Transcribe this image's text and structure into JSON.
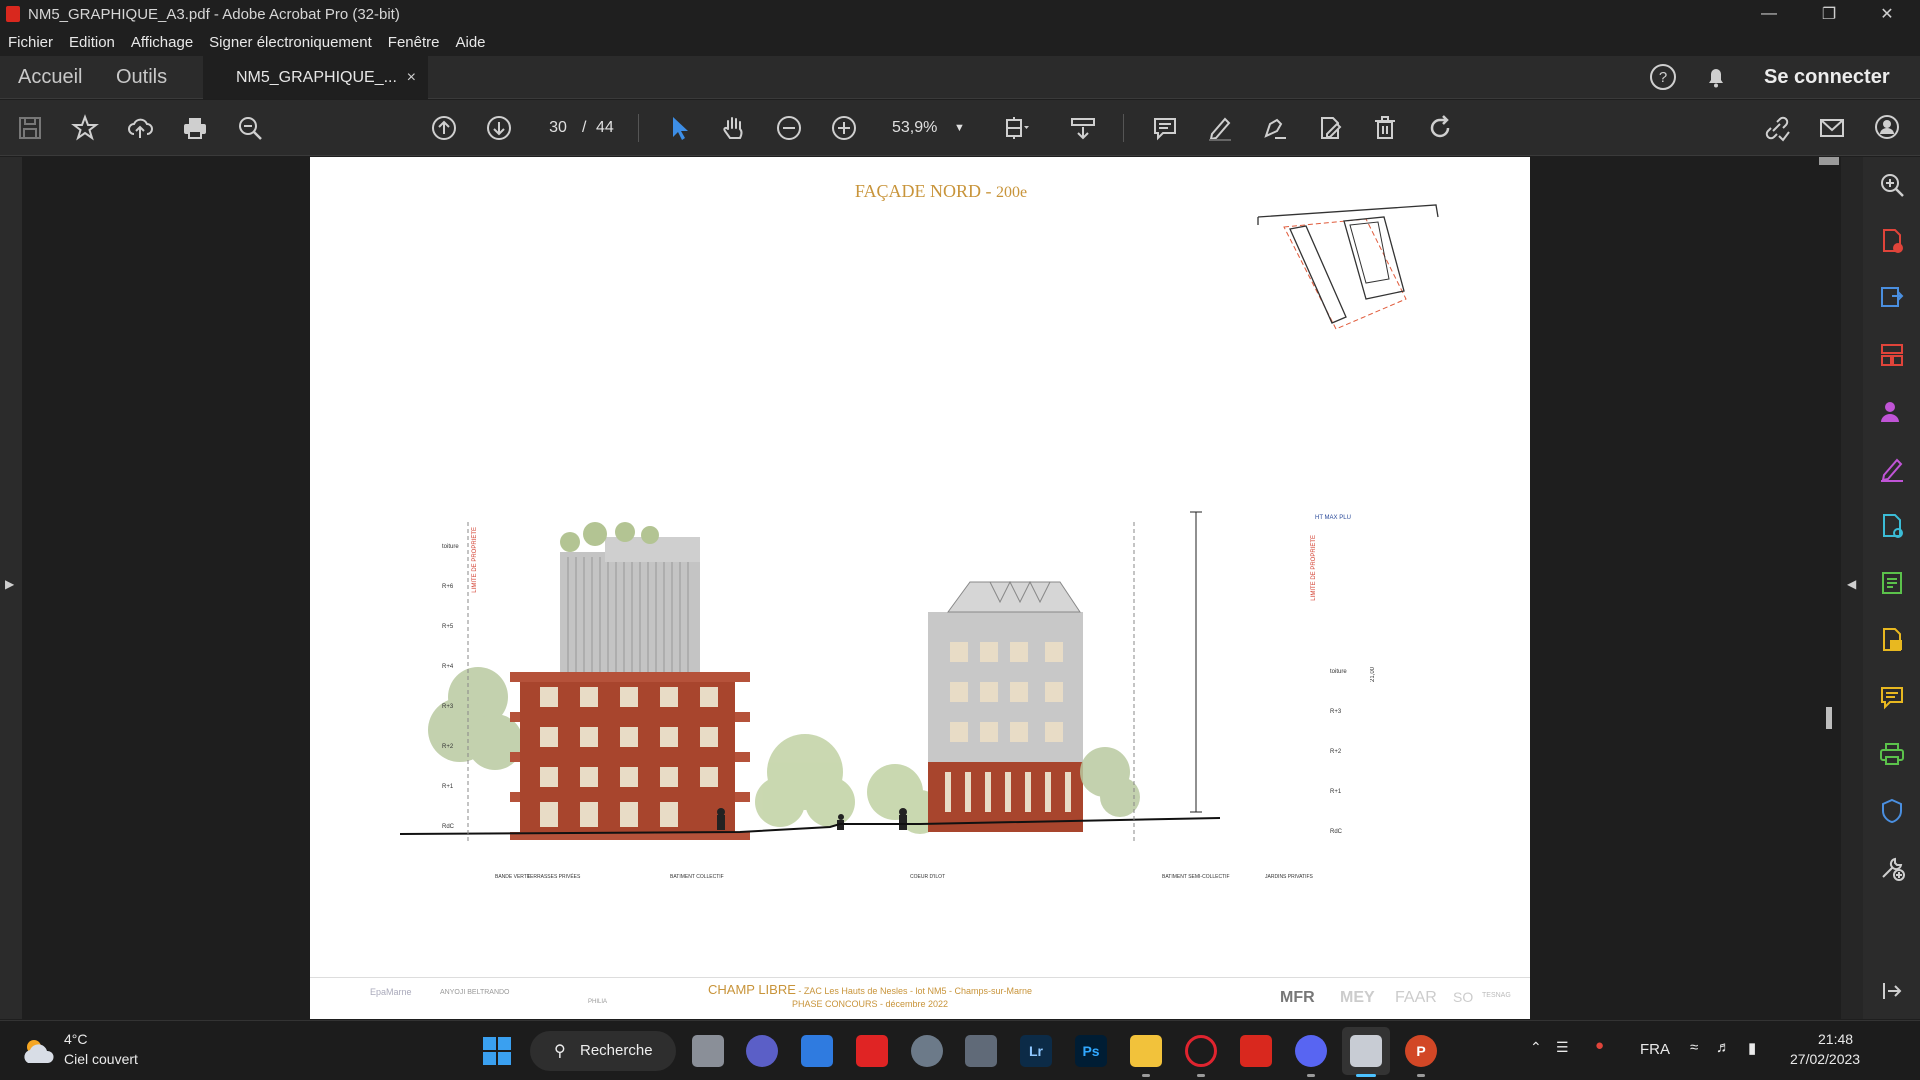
{
  "window": {
    "title": "NM5_GRAPHIQUE_A3.pdf - Adobe Acrobat Pro (32-bit)"
  },
  "menu": [
    "Fichier",
    "Edition",
    "Affichage",
    "Signer électroniquement",
    "Fenêtre",
    "Aide"
  ],
  "tabs": {
    "home": "Accueil",
    "tools": "Outils",
    "doc": "NM5_GRAPHIQUE_...",
    "close": "×"
  },
  "account": {
    "signin": "Se connecter"
  },
  "toolbar": {
    "page_current": "30",
    "page_sep": "/",
    "page_total": "44",
    "zoom": "53,9%"
  },
  "document": {
    "heading": "FAÇADE NORD",
    "heading_sep": " - ",
    "heading_sub": "200e",
    "labels": {
      "limit": "LIMITE DE PROPRIÉTÉ",
      "ht_max": "HT MAX PLU",
      "height_val": "21,00",
      "levels_left": [
        "toiture",
        "R+6",
        "R+5",
        "R+4",
        "R+3",
        "R+2",
        "R+1",
        "RdC"
      ],
      "levels_right": [
        "toiture",
        "R+3",
        "R+2",
        "R+1",
        "RdC"
      ],
      "ground": [
        "BANDE VERTE",
        "TERRASSES PRIVÉES",
        "BATIMENT COLLECTIF",
        "COEUR D'ILOT",
        "BATIMENT SEMI-COLLECTIF",
        "JARDINS PRIVATIFS"
      ]
    },
    "footer": {
      "project": "CHAMP LIBRE",
      "project_detail": " - ZAC Les Hauts de Nesles - lot NM5 - Champs-sur-Marne",
      "phase": "PHASE CONCOURS - décembre 2022",
      "logos_left": [
        "EpaMarne",
        "ANYOJI BELTRANDO",
        "PHILIA"
      ],
      "logos_right": [
        "MFR",
        "MEY",
        "FAAR",
        "SO",
        "TESNAG"
      ]
    }
  },
  "taskbar": {
    "weather_temp": "4°C",
    "weather_desc": "Ciel couvert",
    "search": "Recherche",
    "lang": "FRA",
    "time": "21:48",
    "date": "27/02/2023"
  },
  "colors": {
    "accent": "#c8943a",
    "brick": "#a8452d",
    "acrobat_red": "#d9281e"
  }
}
